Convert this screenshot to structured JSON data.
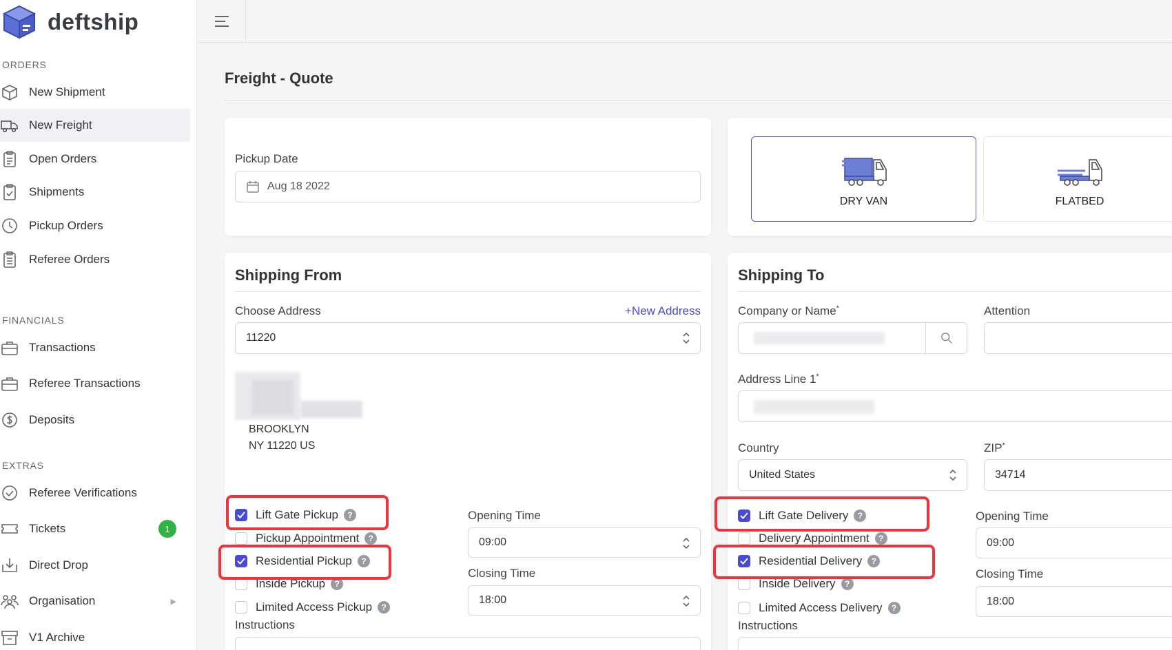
{
  "app": {
    "name": "deftship"
  },
  "sidebar": {
    "sections": {
      "orders": "ORDERS",
      "financials": "FINANCIALS",
      "extras": "EXTRAS"
    },
    "items": [
      {
        "label": "New Shipment",
        "icon": "box-icon"
      },
      {
        "label": "New Freight",
        "icon": "truck-icon",
        "active": true
      },
      {
        "label": "Open Orders",
        "icon": "clipboard-icon"
      },
      {
        "label": "Shipments",
        "icon": "clipboard-check-icon"
      },
      {
        "label": "Pickup Orders",
        "icon": "clock-icon"
      },
      {
        "label": "Referee Orders",
        "icon": "clipboard-list-icon"
      },
      {
        "label": "Transactions",
        "icon": "briefcase-icon"
      },
      {
        "label": "Referee Transactions",
        "icon": "briefcase-icon"
      },
      {
        "label": "Deposits",
        "icon": "dollar-icon"
      },
      {
        "label": "Referee Verifications",
        "icon": "check-circle-icon"
      },
      {
        "label": "Tickets",
        "icon": "ticket-icon",
        "badge": "1"
      },
      {
        "label": "Direct Drop",
        "icon": "drop-icon"
      },
      {
        "label": "Organisation",
        "icon": "users-icon"
      },
      {
        "label": "V1 Archive",
        "icon": "archive-icon"
      }
    ]
  },
  "page": {
    "title": "Freight - Quote"
  },
  "pickup": {
    "label": "Pickup Date",
    "value": "Aug 18 2022"
  },
  "trucks": [
    {
      "label": "DRY VAN",
      "selected": true
    },
    {
      "label": "FLATBED",
      "selected": false
    }
  ],
  "from": {
    "title": "Shipping From",
    "choose_label": "Choose Address",
    "new_address": "+New Address",
    "address_value": "11220",
    "city": "BROOKLYN",
    "state_zip": "NY 11220 US",
    "options": [
      {
        "label": "Lift Gate Pickup",
        "checked": true
      },
      {
        "label": "Pickup Appointment",
        "checked": false
      },
      {
        "label": "Residential Pickup",
        "checked": true
      },
      {
        "label": "Inside Pickup",
        "checked": false
      },
      {
        "label": "Limited Access Pickup",
        "checked": false
      }
    ],
    "opening_label": "Opening Time",
    "opening_value": "09:00",
    "closing_label": "Closing Time",
    "closing_value": "18:00",
    "instructions_label": "Instructions"
  },
  "to": {
    "title": "Shipping To",
    "company_label": "Company or Name",
    "attention_label": "Attention",
    "address1_label": "Address Line 1",
    "country_label": "Country",
    "country_value": "United States",
    "zip_label": "ZIP",
    "zip_value": "34714",
    "options": [
      {
        "label": "Lift Gate Delivery",
        "checked": true
      },
      {
        "label": "Delivery Appointment",
        "checked": false
      },
      {
        "label": "Residential Delivery",
        "checked": true
      },
      {
        "label": "Inside Delivery",
        "checked": false
      },
      {
        "label": "Limited Access Delivery",
        "checked": false
      }
    ],
    "opening_label": "Opening Time",
    "opening_value": "09:00",
    "closing_label": "Closing Time",
    "closing_value": "18:00",
    "instructions_label": "Instructions"
  },
  "colors": {
    "accent": "#4a4ad8",
    "highlight": "#f0323c",
    "badge": "#2fb344"
  }
}
